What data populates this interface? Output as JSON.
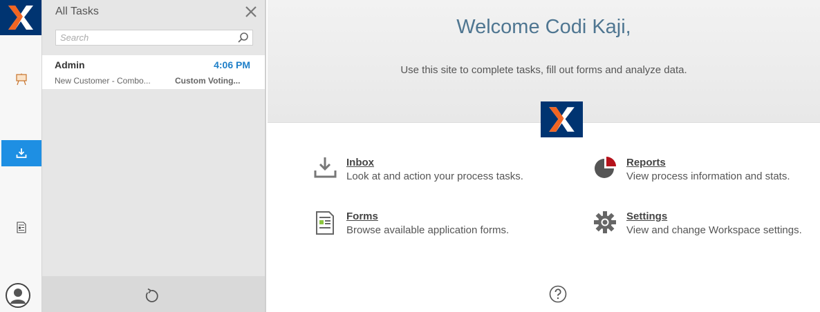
{
  "panel": {
    "title": "All Tasks",
    "search_placeholder": "Search"
  },
  "tasks": [
    {
      "name": "Admin",
      "time": "4:06 PM",
      "subject": "New Customer - Combo...",
      "process": "Custom Voting..."
    }
  ],
  "main": {
    "welcome": "Welcome Codi Kaji,",
    "intro": "Use this site to complete tasks, fill out forms and analyze data.",
    "tiles": [
      {
        "title": "Inbox",
        "desc": "Look at and action your process tasks."
      },
      {
        "title": "Reports",
        "desc": "View process information and stats."
      },
      {
        "title": "Forms",
        "desc": "Browse available application forms."
      },
      {
        "title": "Settings",
        "desc": "View and change Workspace settings."
      }
    ]
  },
  "colors": {
    "brand_navy": "#003471",
    "brand_orange": "#f26522",
    "accent_blue": "#1e8fe3",
    "report_red": "#b5121b"
  },
  "icons": {
    "rail": [
      "easel-icon",
      "inbox-download-icon",
      "form-document-icon",
      "user-avatar-icon"
    ],
    "tiles": [
      "inbox-tray-icon",
      "pie-chart-icon",
      "form-icon",
      "gear-icon"
    ]
  }
}
